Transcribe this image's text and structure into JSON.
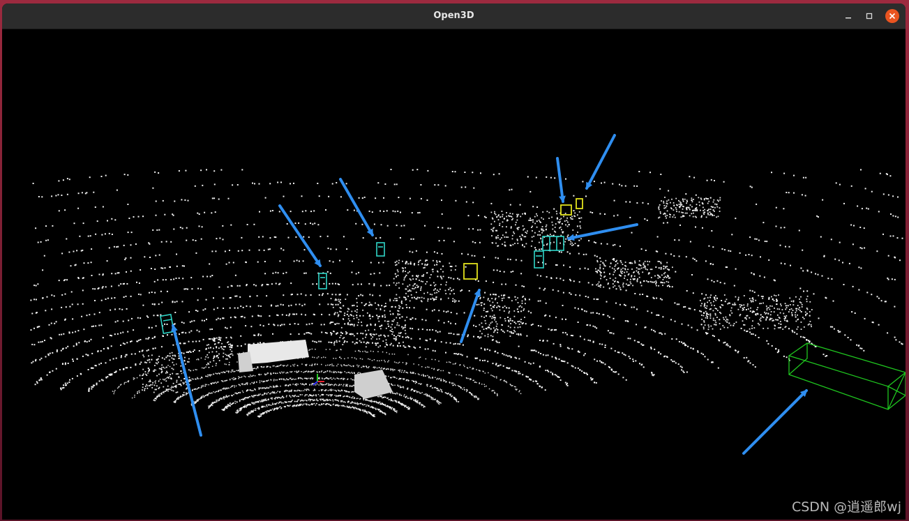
{
  "window": {
    "title": "Open3D"
  },
  "colors": {
    "arrow": "#2f8ef0",
    "box_car": "#2fd6c8",
    "box_pedestrian": "#e3e31d",
    "box_truck": "#1fc61f",
    "points": "#ffffff",
    "close_button": "#e95420"
  },
  "watermark": {
    "text": "CSDN @逍遥郎wj"
  },
  "scene": {
    "type": "lidar-point-cloud",
    "annotation_arrow_count": 8,
    "bounding_boxes": [
      {
        "class": "car",
        "color": "cyan"
      },
      {
        "class": "car",
        "color": "cyan"
      },
      {
        "class": "car",
        "color": "cyan"
      },
      {
        "class": "car",
        "color": "cyan"
      },
      {
        "class": "car",
        "color": "cyan"
      },
      {
        "class": "pedestrian",
        "color": "yellow"
      },
      {
        "class": "pedestrian",
        "color": "yellow"
      },
      {
        "class": "pedestrian",
        "color": "yellow"
      },
      {
        "class": "truck",
        "color": "green"
      }
    ]
  }
}
